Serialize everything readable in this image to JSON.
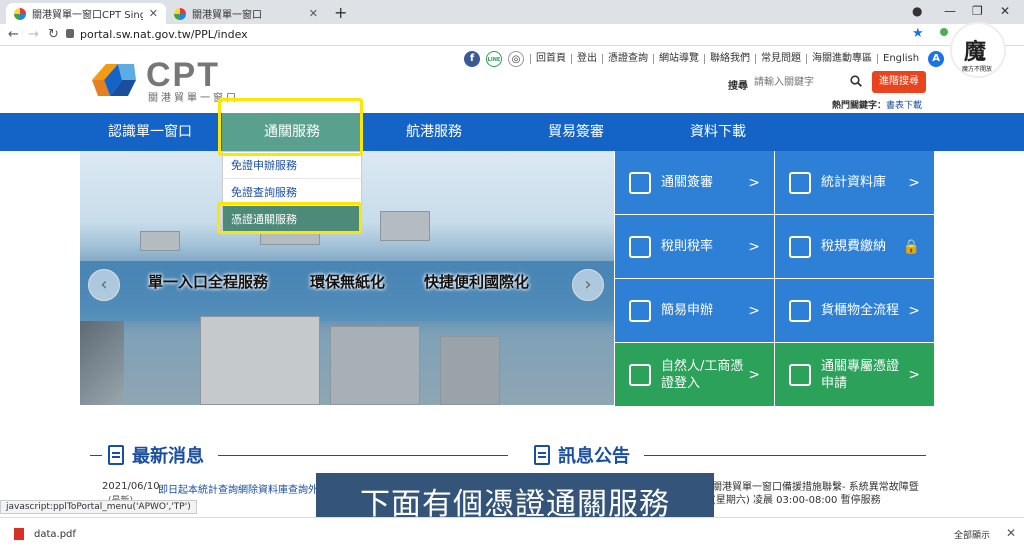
{
  "browser": {
    "tabs": [
      {
        "label": "關港貿單一窗口CPT Single Win"
      },
      {
        "label": "關港貿單一窗口"
      }
    ],
    "new_tab": "+",
    "url": "portal.sw.nat.gov.tw/PPL/index"
  },
  "logo": {
    "text": "CPT",
    "subtitle": "關港貿單一窗口"
  },
  "toplinks": {
    "social": [
      "f",
      "LINE",
      "◎"
    ],
    "links": [
      "回首頁",
      "登出",
      "憑證查詢",
      "網站導覽",
      "聯絡我們",
      "常見問題",
      "海關進動專區",
      "English"
    ],
    "a_badge": "A"
  },
  "search": {
    "label": "搜尋",
    "placeholder": "請輸入關鍵字",
    "advanced": "進階搜尋"
  },
  "hot_keywords": {
    "label": "熱門關鍵字：",
    "link": "書表下載"
  },
  "mainnav": [
    "認識單一窗口",
    "通關服務",
    "航港服務",
    "貿易簽審",
    "資料下載"
  ],
  "dropdown": [
    "免證申辦服務",
    "免證查詢服務",
    "憑證通關服務"
  ],
  "hero": {
    "texts": [
      "單一入口全程服務",
      "環保無紙化",
      "快捷便利國際化"
    ],
    "prev": "‹",
    "next": "›"
  },
  "tiles": [
    {
      "label": "通關簽審",
      "arrow": ">"
    },
    {
      "label": "統計資料庫",
      "arrow": ">"
    },
    {
      "label": "稅則稅率",
      "arrow": ">"
    },
    {
      "label": "稅規費繳納",
      "arrow": ""
    },
    {
      "label": "簡易申辦",
      "arrow": ">"
    },
    {
      "label": "貨櫃物全流程",
      "arrow": ">"
    },
    {
      "label": "自然人/工商憑證登入",
      "arrow": ">"
    },
    {
      "label": "通關專屬憑證申請",
      "arrow": ">"
    }
  ],
  "news": {
    "title": "最新消息",
    "date": "2021/06/10",
    "text": "即日起本統計查詢網除資料庫查詢外",
    "sub": "(最新)"
  },
  "announcement": {
    "title": "訊息公告",
    "text": "關港貿單一窗口備援措施聯繫- 系統異常故障暨 (星期六) 凌晨 03:00-08:00 暫停服務"
  },
  "subtitle": "下面有個憑證通關服務",
  "statusbar": "javascript:pplToPortal_menu('APWO','TP')",
  "download": {
    "file": "data.pdf",
    "show_all": "全部顯示",
    "close": "✕"
  },
  "ext_icon": {
    "glyph": "魔",
    "caption": "魔方不開放"
  },
  "colors": {
    "nav": "#1464c8",
    "active_nav": "#5aa08e",
    "tile_blue": "#2e7fd6",
    "tile_green": "#2ba15a",
    "highlight": "#ffe600",
    "advanced_search": "#e8451f"
  }
}
